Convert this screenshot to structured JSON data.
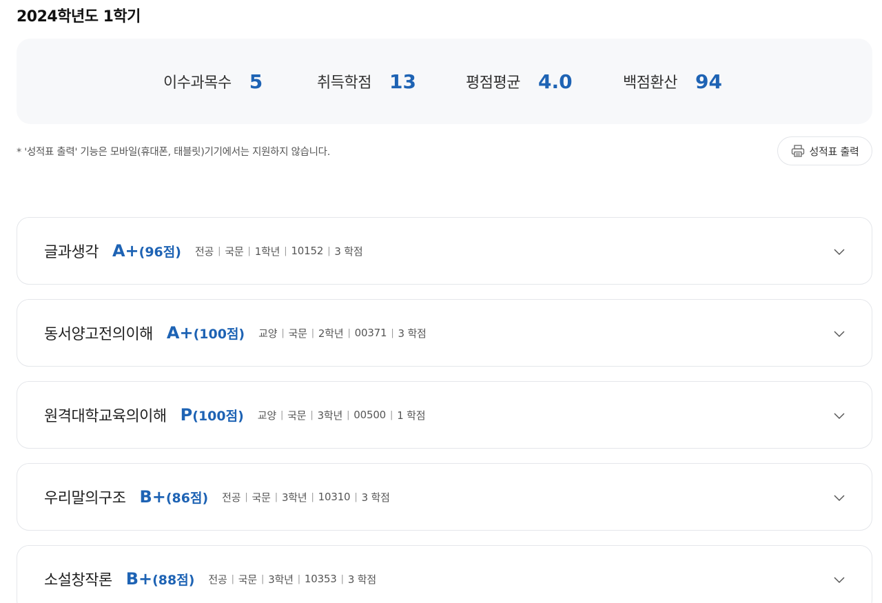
{
  "semester": {
    "title": "2024학년도 1학기"
  },
  "summary": {
    "course_count": {
      "label": "이수과목수",
      "value": "5"
    },
    "credits_earned": {
      "label": "취득학점",
      "value": "13"
    },
    "gpa": {
      "label": "평점평균",
      "value": "4.0"
    },
    "percentile": {
      "label": "백점환산",
      "value": "94"
    }
  },
  "notice": "* '성적표 출력' 기능은 모바일(휴대폰, 태블릿)기기에서는 지원하지 않습니다.",
  "print_button": {
    "label": "성적표 출력",
    "icon": "printer-icon"
  },
  "courses": [
    {
      "name": "글과생각",
      "grade": "A+",
      "score": "(96점)",
      "type": "전공",
      "department": "국문",
      "year": "1학년",
      "code": "10152",
      "credits": "3 학점"
    },
    {
      "name": "동서양고전의이해",
      "grade": "A+",
      "score": "(100점)",
      "type": "교양",
      "department": "국문",
      "year": "2학년",
      "code": "00371",
      "credits": "3 학점"
    },
    {
      "name": "원격대학교육의이해",
      "grade": "P",
      "score": "(100점)",
      "type": "교양",
      "department": "국문",
      "year": "3학년",
      "code": "00500",
      "credits": "1 학점"
    },
    {
      "name": "우리말의구조",
      "grade": "B+",
      "score": "(86점)",
      "type": "전공",
      "department": "국문",
      "year": "3학년",
      "code": "10310",
      "credits": "3 학점"
    },
    {
      "name": "소설창작론",
      "grade": "B+",
      "score": "(88점)",
      "type": "전공",
      "department": "국문",
      "year": "3학년",
      "code": "10353",
      "credits": "3 학점"
    }
  ],
  "meta_separator": "|",
  "colors": {
    "accent": "#1e63b4",
    "summary_bg": "#f7f8fa",
    "card_border": "#e4e6ea"
  }
}
